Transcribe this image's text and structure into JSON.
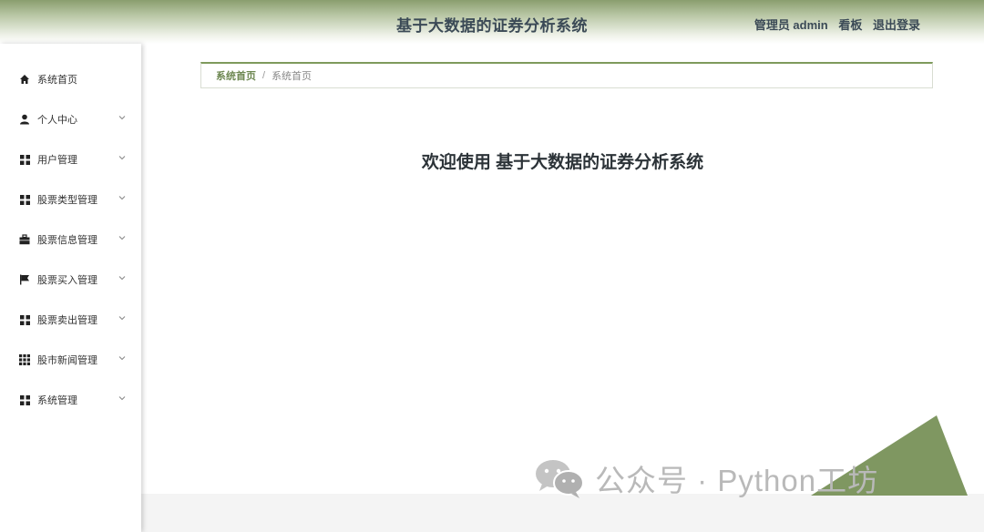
{
  "header": {
    "title": "基于大数据的证券分析系统",
    "role": "管理员 admin",
    "board_link": "看板",
    "logout_link": "退出登录"
  },
  "sidebar": {
    "items": [
      {
        "label": "系统首页",
        "icon": "home-icon",
        "has_submenu": false
      },
      {
        "label": "个人中心",
        "icon": "user-icon",
        "has_submenu": true
      },
      {
        "label": "用户管理",
        "icon": "grid-icon",
        "has_submenu": true
      },
      {
        "label": "股票类型管理",
        "icon": "grid-icon",
        "has_submenu": true
      },
      {
        "label": "股票信息管理",
        "icon": "briefcase-icon",
        "has_submenu": true
      },
      {
        "label": "股票买入管理",
        "icon": "flag-icon",
        "has_submenu": true
      },
      {
        "label": "股票卖出管理",
        "icon": "grid-icon",
        "has_submenu": true
      },
      {
        "label": "股市新闻管理",
        "icon": "apps-icon",
        "has_submenu": true
      },
      {
        "label": "系统管理",
        "icon": "grid-icon",
        "has_submenu": true
      }
    ]
  },
  "breadcrumb": {
    "home": "系统首页",
    "separator": "/",
    "current": "系统首页"
  },
  "main": {
    "welcome": "欢迎使用 基于大数据的证券分析系统"
  },
  "watermark": {
    "text": "公众号 · Python工坊"
  },
  "colors": {
    "accent": "#7e9a5c",
    "header_text": "#3b4a56",
    "triangle": "#7f9761"
  }
}
